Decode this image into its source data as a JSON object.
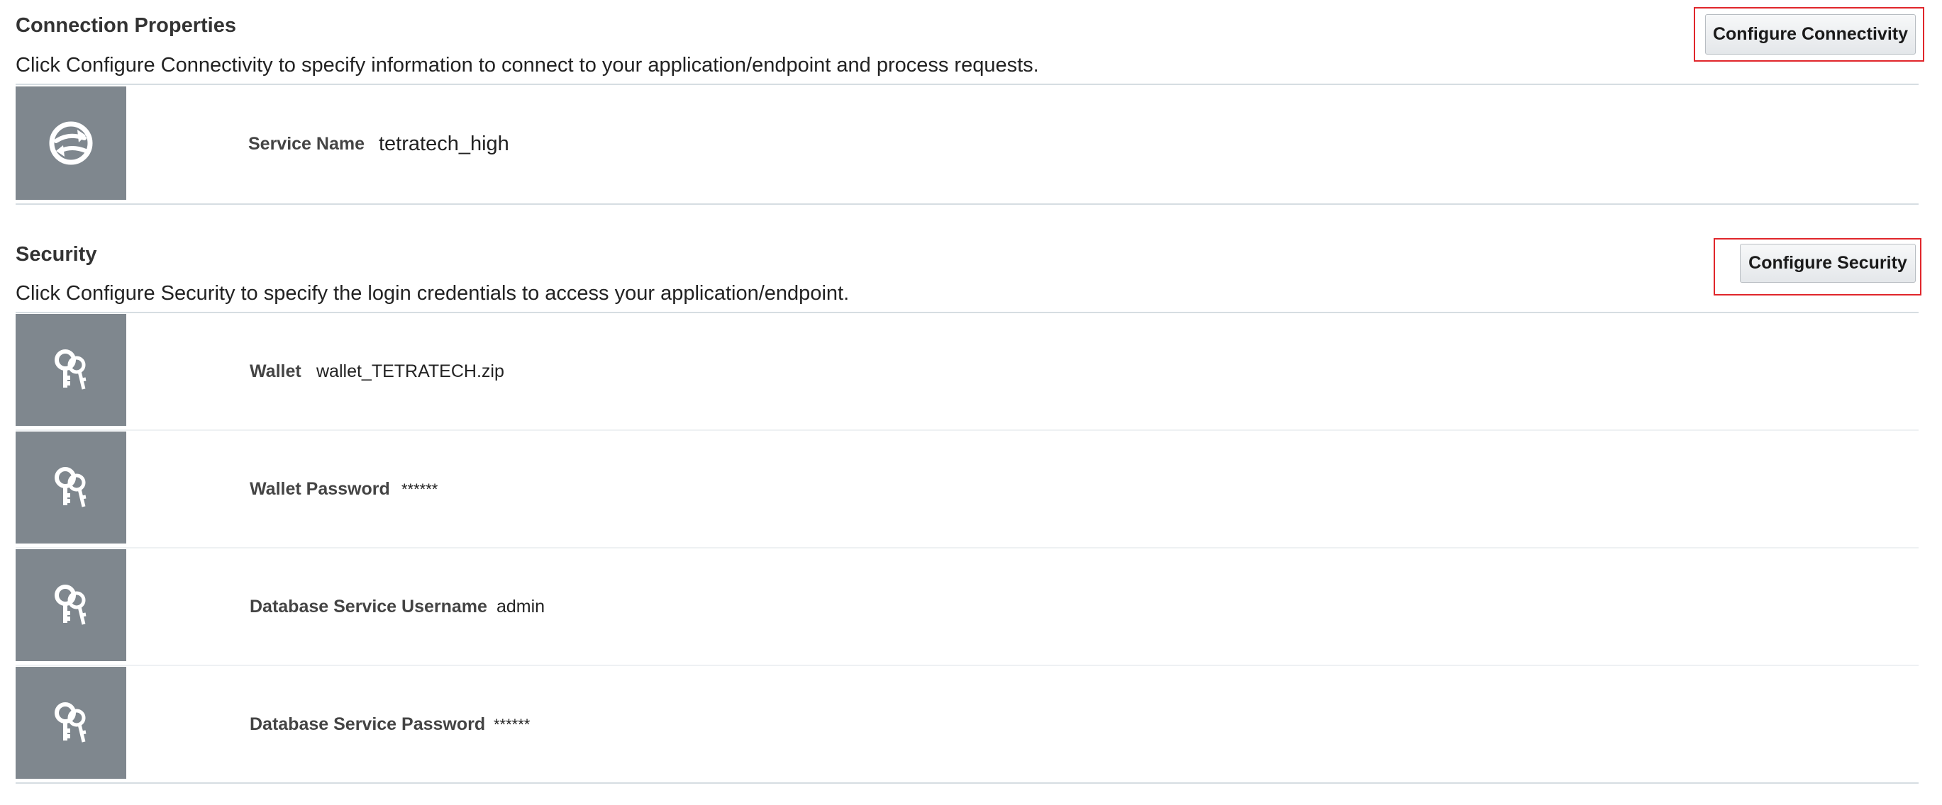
{
  "connection": {
    "title": "Connection Properties",
    "description": "Click Configure Connectivity to specify information to connect to your application/endpoint and process requests.",
    "button_label": "Configure Connectivity",
    "icon": "connectivity-icon",
    "properties": [
      {
        "label": "Service Name",
        "value": "tetratech_high"
      }
    ]
  },
  "security": {
    "title": "Security",
    "description": "Click Configure Security to specify the login credentials to access your application/endpoint.",
    "button_label": "Configure Security",
    "icon": "key-icon",
    "properties": [
      {
        "label": "Wallet",
        "value": "wallet_TETRATECH.zip"
      },
      {
        "label": "Wallet Password",
        "value": "******"
      },
      {
        "label": "Database Service Username",
        "value": "admin"
      },
      {
        "label": "Database Service Password",
        "value": "******"
      }
    ]
  },
  "colors": {
    "highlight_border": "#e0262b",
    "tile_background": "#7f878e",
    "divider": "#d6dde2"
  }
}
